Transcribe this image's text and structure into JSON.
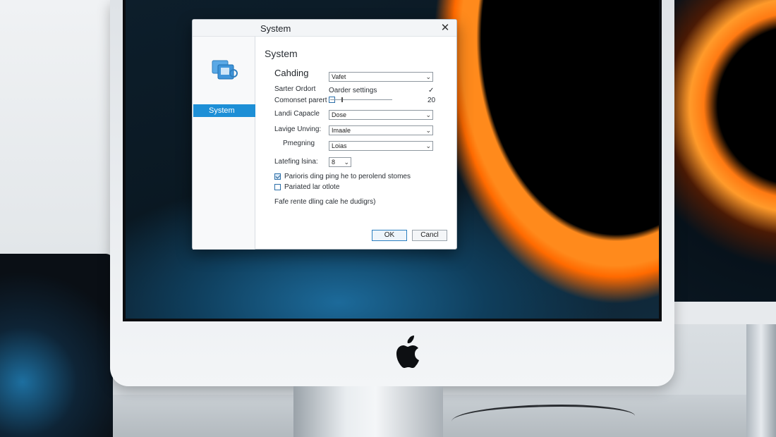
{
  "dialog": {
    "title": "System",
    "close_symbol": "✕",
    "close_icon": "close-icon"
  },
  "sidebar": {
    "icon": "system-settings-icon",
    "items": [
      {
        "label": "System",
        "selected": true
      }
    ]
  },
  "content": {
    "section_title": "System",
    "subsection": "Cahding",
    "rows": {
      "cahding_select": "Vafet",
      "sarter_label": "Sarter Ordort",
      "sarter_value": "Oarder settings",
      "sarter_check": "✓",
      "comonet_label": "Comonset parert",
      "comonet_value": "20",
      "landi_label": "Landi Capacle",
      "landi_select": "Dose",
      "lavige_label": "Lavige Unving:",
      "lavige_select": "Imaale",
      "pmegning_label": "Pmegning",
      "pmegning_select": "Loias",
      "latefing_label": "Latefing lsina:",
      "latefing_select": "8"
    },
    "checkboxes": [
      {
        "label": "Parioris ding ping he to perolend stomes",
        "checked": true
      },
      {
        "label": "Pariated lar otlote",
        "checked": false
      }
    ],
    "footnote": "Fafe rente dling cale he dudigrs)"
  },
  "buttons": {
    "ok": "OK",
    "cancel": "Cancl"
  },
  "colors": {
    "accent": "#1d8fd6",
    "screen_orange": "#ff8a1c",
    "screen_dark": "#0a1822"
  },
  "brand": {
    "logo_icon": "apple-logo-icon"
  }
}
